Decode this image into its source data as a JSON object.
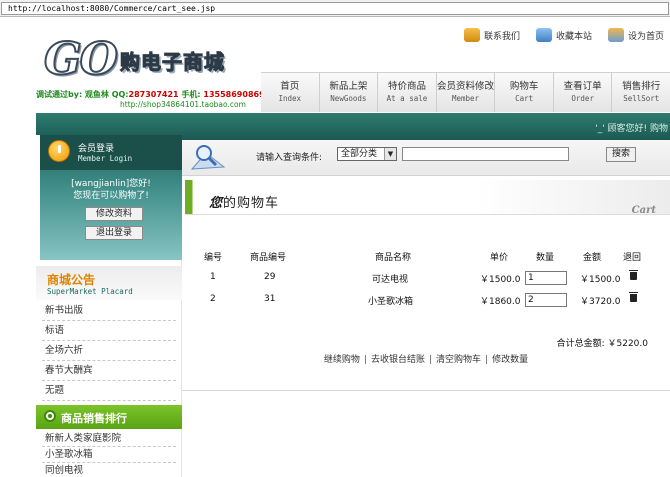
{
  "browser": {
    "url": "http://localhost:8080/Commerce/cart_see.jsp"
  },
  "header": {
    "logo_go": "GO",
    "logo_text": "购电子商城",
    "promo_prefix": "调试通过by: 观鱼林 QQ:",
    "promo_qq": "287307421",
    "promo_phone_label": " 手机: ",
    "promo_phone": "13558690869",
    "promo_url": "http://shop34864101.taobao.com",
    "top_links": [
      {
        "label": "联系我们",
        "icon": "contact-icon"
      },
      {
        "label": "收藏本站",
        "icon": "star-icon"
      },
      {
        "label": "设为首页",
        "icon": "home-icon"
      }
    ],
    "nav": [
      {
        "cn": "首页",
        "en": "Index"
      },
      {
        "cn": "新品上架",
        "en": "NewGoods"
      },
      {
        "cn": "特价商品",
        "en": "At a sale"
      },
      {
        "cn": "会员资料修改",
        "en": "Member"
      },
      {
        "cn": "购物车",
        "en": "Cart"
      },
      {
        "cn": "查看订单",
        "en": "Order"
      },
      {
        "cn": "销售排行",
        "en": "SellSort"
      }
    ]
  },
  "greenbar": {
    "welcome": "'_' 顾客您好! 购物"
  },
  "sidebar": {
    "login": {
      "title": "会员登录",
      "subtitle": "Member Login",
      "message_line1": "[wangjianlin]您好!",
      "message_line2": "您现在可以购物了!",
      "edit_label": "修改资料",
      "logout_label": "退出登录"
    },
    "notice": {
      "title": "商城公告",
      "subtitle": "SuperMarket Placard",
      "items": [
        "新书出版",
        "标语",
        "全场六折",
        "春节大酬宾",
        "无题"
      ]
    },
    "ranking": {
      "title": "商品销售排行",
      "items": [
        "新新人类家庭影院",
        "小圣歌冰箱",
        "同创电视"
      ]
    }
  },
  "search": {
    "label": "请输入查询条件:",
    "category": "全部分类",
    "query": "",
    "button": "搜索"
  },
  "cart": {
    "title_bold": "您",
    "title_rest": "的购物车",
    "title_en": "Cart",
    "columns": [
      "编号",
      "商品编号",
      "商品名称",
      "单价",
      "数量",
      "金额",
      "退回"
    ],
    "rows": [
      {
        "no": "1",
        "goods_id": "29",
        "name": "可达电视",
        "price": "￥1500.0",
        "qty": "1",
        "amount": "￥1500.0"
      },
      {
        "no": "2",
        "goods_id": "31",
        "name": "小圣歌冰箱",
        "price": "￥1860.0",
        "qty": "2",
        "amount": "￥3720.0"
      }
    ],
    "total_label": "合计总金额:",
    "total_value": "￥5220.0",
    "actions": [
      "继续购物",
      "去收银台结账",
      "清空购物车",
      "修改数量"
    ]
  },
  "colors": {
    "accent_green": "#1b5a52",
    "rank_green": "#6fae24",
    "notice_orange": "#e08400"
  }
}
